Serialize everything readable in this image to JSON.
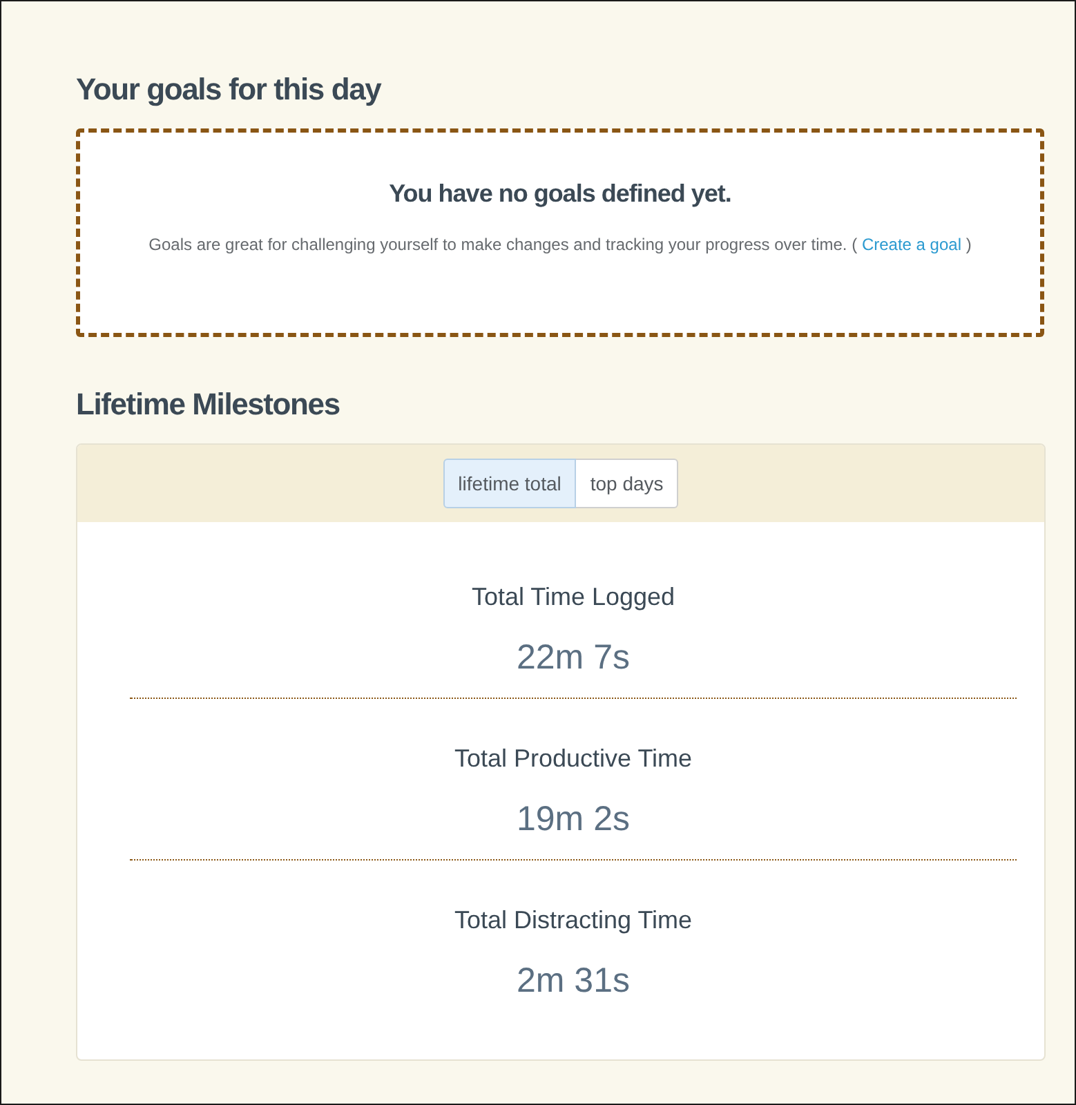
{
  "goals": {
    "title": "Your goals for this day",
    "empty_title": "You have no goals defined yet.",
    "description": {
      "text": "Goals are great for challenging yourself to make changes and tracking your progress over time. (",
      "link": "Create a goal",
      "end": ")"
    }
  },
  "milestones": {
    "title": "Lifetime Milestones",
    "tabs": [
      {
        "label": "lifetime total",
        "selected": true
      },
      {
        "label": "top days",
        "selected": false
      }
    ],
    "stats": [
      {
        "label": "Total Time Logged",
        "value": "22m 7s"
      },
      {
        "label": "Total Productive Time",
        "value": "19m 2s"
      },
      {
        "label": "Total Distracting Time",
        "value": "2m 31s"
      }
    ]
  }
}
